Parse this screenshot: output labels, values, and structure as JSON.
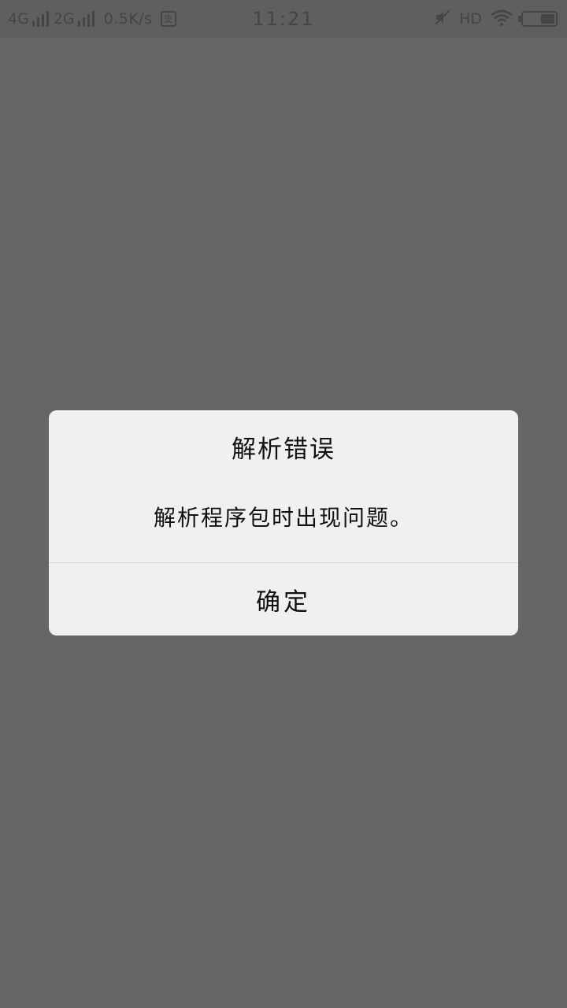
{
  "status_bar": {
    "network_1": "4G",
    "network_2": "2G",
    "speed": "0.5K/s",
    "app_icon_glyph": "支",
    "time": "11:21",
    "hd": "HD",
    "battery_level": 0.45,
    "icons": [
      "signal-4g-icon",
      "signal-2g-icon",
      "app-notification-icon",
      "mute-icon",
      "wifi-icon",
      "battery-icon"
    ]
  },
  "dialog": {
    "title": "解析错误",
    "message": "解析程序包时出现问题。",
    "ok_label": "确定"
  },
  "colors": {
    "overlay": "#666666",
    "dialog_bg": "#f0f0f0",
    "text": "#111111",
    "status_text": "#454545"
  }
}
